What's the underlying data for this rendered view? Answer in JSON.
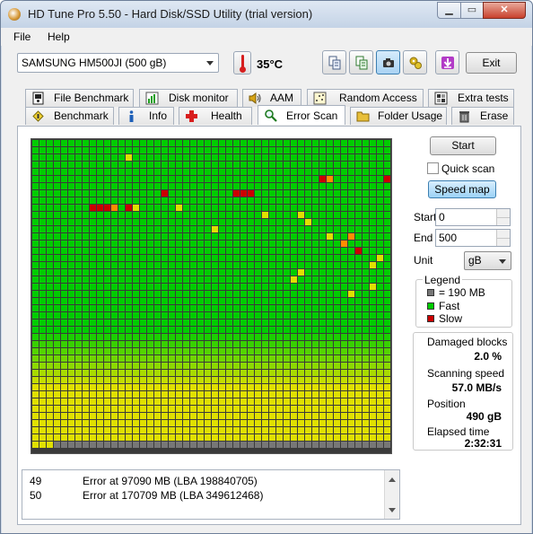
{
  "window": {
    "title": "HD Tune Pro 5.50 - Hard Disk/SSD Utility (trial version)",
    "min_label": "▁",
    "max_label": "▭",
    "close_label": "✕"
  },
  "menu": {
    "file": "File",
    "help": "Help"
  },
  "toolbar": {
    "drive": "SAMSUNG HM500JI (500 gB)",
    "temperature": "35°C",
    "exit_label": "Exit"
  },
  "tabs_top": [
    "File Benchmark",
    "Disk monitor",
    "AAM",
    "Random Access",
    "Extra tests"
  ],
  "tabs_bottom": [
    "Benchmark",
    "Info",
    "Health",
    "Error Scan",
    "Folder Usage",
    "Erase"
  ],
  "controls": {
    "start_button": "Start",
    "quick_scan": "Quick scan",
    "speed_map": "Speed map",
    "start_label": "Start",
    "start_value": "0",
    "end_label": "End",
    "end_value": "500",
    "unit_label": "Unit",
    "unit_value": "gB"
  },
  "legend": {
    "title": "Legend",
    "block_size": "= 190 MB",
    "fast": "Fast",
    "slow": "Slow",
    "colors": {
      "unscanned": "#777777",
      "fast": "#00cc00",
      "slow": "#cc0000",
      "slow_medium": "#ff8c00",
      "medium": "#e0e000"
    }
  },
  "stats": {
    "damaged_label": "Damaged blocks",
    "damaged_value": "2.0 %",
    "speed_label": "Scanning speed",
    "speed_value": "57.0 MB/s",
    "position_label": "Position",
    "position_value": "490 gB",
    "elapsed_label": "Elapsed time",
    "elapsed_value": "2:32:31"
  },
  "log": [
    {
      "num": "49",
      "msg": "Error at 97090 MB (LBA 198840705)"
    },
    {
      "num": "50",
      "msg": "Error at 170709 MB (LBA 349612468)"
    }
  ],
  "scan_map": {
    "columns": 50,
    "rows": 43,
    "green_until_row": 27,
    "fade_rows": 8,
    "scanned_rows_fill": 42,
    "last_row_scanned_cols": 3,
    "red_cells": [
      [
        5,
        40
      ],
      [
        5,
        49
      ],
      [
        7,
        18
      ],
      [
        7,
        28
      ],
      [
        7,
        29
      ],
      [
        7,
        30
      ],
      [
        9,
        8
      ],
      [
        9,
        9
      ],
      [
        9,
        10
      ],
      [
        9,
        13
      ],
      [
        15,
        45
      ]
    ],
    "orange_cells": [
      [
        5,
        41
      ],
      [
        9,
        11
      ],
      [
        13,
        44
      ],
      [
        14,
        43
      ]
    ],
    "yellow_cells": [
      [
        2,
        13
      ],
      [
        9,
        14
      ],
      [
        9,
        20
      ],
      [
        10,
        32
      ],
      [
        10,
        37
      ],
      [
        11,
        38
      ],
      [
        12,
        25
      ],
      [
        13,
        41
      ],
      [
        16,
        48
      ],
      [
        17,
        47
      ],
      [
        18,
        37
      ],
      [
        19,
        36
      ],
      [
        20,
        47
      ],
      [
        21,
        44
      ]
    ]
  }
}
